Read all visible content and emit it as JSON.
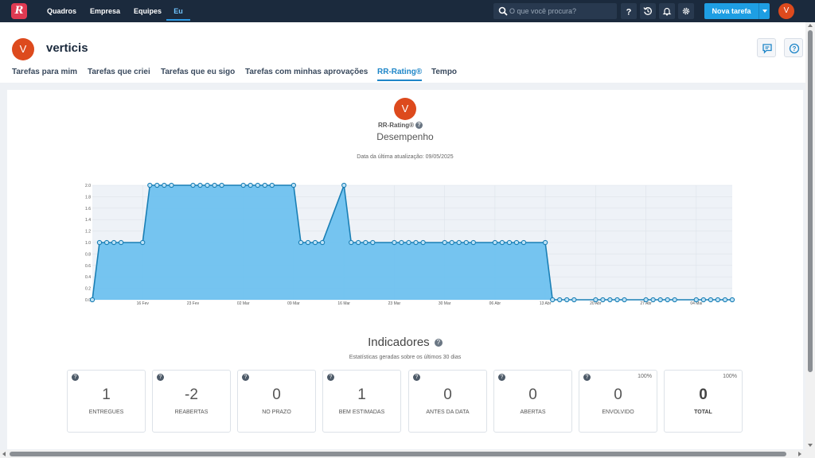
{
  "topbar": {
    "logo_letter": "R",
    "nav": [
      {
        "label": "Quadros"
      },
      {
        "label": "Empresa"
      },
      {
        "label": "Equipes"
      },
      {
        "label": "Eu"
      }
    ],
    "search_placeholder": "O que você procura?",
    "new_task_label": "Nova tarefa",
    "avatar_initial": "V"
  },
  "profile": {
    "avatar_initial": "V",
    "name": "verticis"
  },
  "tabs": [
    {
      "label": "Tarefas para mim"
    },
    {
      "label": "Tarefas que criei"
    },
    {
      "label": "Tarefas que eu sigo"
    },
    {
      "label": "Tarefas com minhas aprovações"
    },
    {
      "label": "RR-Rating®"
    },
    {
      "label": "Tempo"
    }
  ],
  "rating": {
    "avatar_initial": "V",
    "label": "RR-Rating®",
    "subtitle": "Desempenho",
    "updated": "Data da última atualização: 09/05/2025"
  },
  "chart_data": {
    "type": "area",
    "ylim": [
      0,
      2.0
    ],
    "y_ticks": [
      "0.0",
      "0.2",
      "0.4",
      "0.6",
      "0.8",
      "1.0",
      "1.2",
      "1.4",
      "1.6",
      "1.8",
      "2.0"
    ],
    "x_ticks": [
      "16 Fev",
      "23 Fev",
      "02 Mar",
      "09 Mar",
      "16 Mar",
      "23 Mar",
      "30 Mar",
      "06 Abr",
      "13 Abr",
      "20 Abr",
      "27 Abr",
      "04 Mai"
    ],
    "grid": true,
    "x_start": "2025-02-09",
    "x_end": "2025-05-09",
    "points": [
      {
        "x": "2025-02-09",
        "y": 0
      },
      {
        "x": "2025-02-10",
        "y": 1
      },
      {
        "x": "2025-02-11",
        "y": 1
      },
      {
        "x": "2025-02-12",
        "y": 1
      },
      {
        "x": "2025-02-13",
        "y": 1
      },
      {
        "x": "2025-02-16",
        "y": 1
      },
      {
        "x": "2025-02-17",
        "y": 2
      },
      {
        "x": "2025-02-18",
        "y": 2
      },
      {
        "x": "2025-02-19",
        "y": 2
      },
      {
        "x": "2025-02-20",
        "y": 2
      },
      {
        "x": "2025-02-23",
        "y": 2
      },
      {
        "x": "2025-02-24",
        "y": 2
      },
      {
        "x": "2025-02-25",
        "y": 2
      },
      {
        "x": "2025-02-26",
        "y": 2
      },
      {
        "x": "2025-02-27",
        "y": 2
      },
      {
        "x": "2025-03-02",
        "y": 2
      },
      {
        "x": "2025-03-03",
        "y": 2
      },
      {
        "x": "2025-03-04",
        "y": 2
      },
      {
        "x": "2025-03-05",
        "y": 2
      },
      {
        "x": "2025-03-06",
        "y": 2
      },
      {
        "x": "2025-03-09",
        "y": 2
      },
      {
        "x": "2025-03-10",
        "y": 1
      },
      {
        "x": "2025-03-11",
        "y": 1
      },
      {
        "x": "2025-03-12",
        "y": 1
      },
      {
        "x": "2025-03-13",
        "y": 1
      },
      {
        "x": "2025-03-16",
        "y": 2
      },
      {
        "x": "2025-03-17",
        "y": 1
      },
      {
        "x": "2025-03-18",
        "y": 1
      },
      {
        "x": "2025-03-19",
        "y": 1
      },
      {
        "x": "2025-03-20",
        "y": 1
      },
      {
        "x": "2025-03-23",
        "y": 1
      },
      {
        "x": "2025-03-24",
        "y": 1
      },
      {
        "x": "2025-03-25",
        "y": 1
      },
      {
        "x": "2025-03-26",
        "y": 1
      },
      {
        "x": "2025-03-27",
        "y": 1
      },
      {
        "x": "2025-03-30",
        "y": 1
      },
      {
        "x": "2025-03-31",
        "y": 1
      },
      {
        "x": "2025-04-01",
        "y": 1
      },
      {
        "x": "2025-04-02",
        "y": 1
      },
      {
        "x": "2025-04-03",
        "y": 1
      },
      {
        "x": "2025-04-06",
        "y": 1
      },
      {
        "x": "2025-04-07",
        "y": 1
      },
      {
        "x": "2025-04-08",
        "y": 1
      },
      {
        "x": "2025-04-09",
        "y": 1
      },
      {
        "x": "2025-04-10",
        "y": 1
      },
      {
        "x": "2025-04-13",
        "y": 1
      },
      {
        "x": "2025-04-14",
        "y": 0
      },
      {
        "x": "2025-04-15",
        "y": 0
      },
      {
        "x": "2025-04-16",
        "y": 0
      },
      {
        "x": "2025-04-17",
        "y": 0
      },
      {
        "x": "2025-04-20",
        "y": 0
      },
      {
        "x": "2025-04-21",
        "y": 0
      },
      {
        "x": "2025-04-22",
        "y": 0
      },
      {
        "x": "2025-04-23",
        "y": 0
      },
      {
        "x": "2025-04-24",
        "y": 0
      },
      {
        "x": "2025-04-27",
        "y": 0
      },
      {
        "x": "2025-04-28",
        "y": 0
      },
      {
        "x": "2025-04-29",
        "y": 0
      },
      {
        "x": "2025-04-30",
        "y": 0
      },
      {
        "x": "2025-05-01",
        "y": 0
      },
      {
        "x": "2025-05-04",
        "y": 0
      },
      {
        "x": "2025-05-05",
        "y": 0
      },
      {
        "x": "2025-05-06",
        "y": 0
      },
      {
        "x": "2025-05-07",
        "y": 0
      },
      {
        "x": "2025-05-08",
        "y": 0
      },
      {
        "x": "2025-05-09",
        "y": 0
      }
    ],
    "colors": {
      "fill": "#6ec1ef",
      "line": "#1a7fb5",
      "plot_bg": "#eef2f7",
      "grid": "#dde3ea"
    }
  },
  "indicators": {
    "title": "Indicadores",
    "subtitle": "Estatísticas geradas sobre os últimos 30 dias",
    "items": [
      {
        "value": "1",
        "label": "ENTREGUES",
        "percent": ""
      },
      {
        "value": "-2",
        "label": "REABERTAS",
        "percent": ""
      },
      {
        "value": "0",
        "label": "NO PRAZO",
        "percent": ""
      },
      {
        "value": "1",
        "label": "BEM ESTIMADAS",
        "percent": ""
      },
      {
        "value": "0",
        "label": "ANTES DA DATA",
        "percent": ""
      },
      {
        "value": "0",
        "label": "ABERTAS",
        "percent": ""
      },
      {
        "value": "0",
        "label": "ENVOLVIDO",
        "percent": "100%"
      },
      {
        "value": "0",
        "label": "TOTAL",
        "percent": "100%"
      }
    ]
  }
}
